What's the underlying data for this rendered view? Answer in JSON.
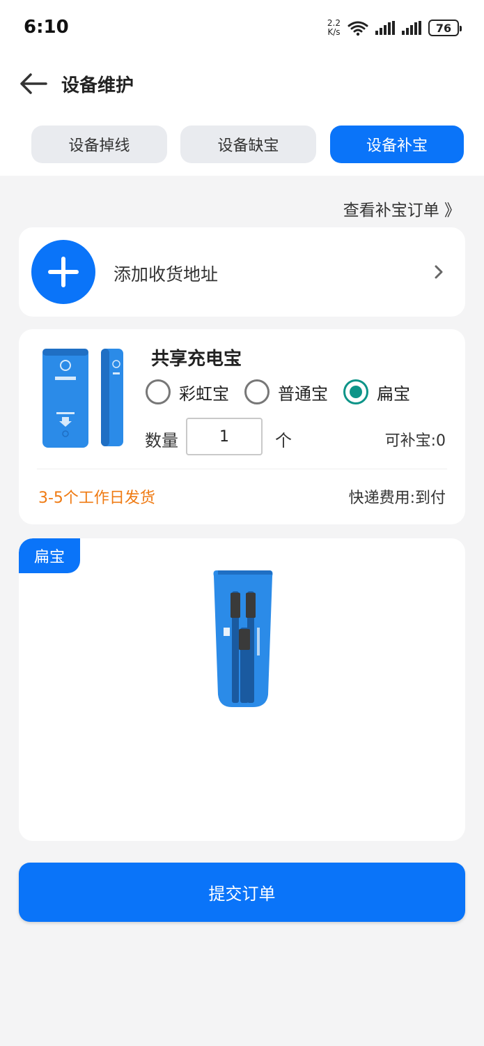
{
  "status_bar": {
    "time": "6:10",
    "net_speed_value": "2.2",
    "net_speed_unit": "K/s",
    "battery": "76"
  },
  "header": {
    "title": "设备维护",
    "back_icon": "arrow-left-icon"
  },
  "tabs": [
    {
      "label": "设备掉线",
      "active": false
    },
    {
      "label": "设备缺宝",
      "active": false
    },
    {
      "label": "设备补宝",
      "active": true
    }
  ],
  "orders_link": "查看补宝订单 》",
  "address": {
    "label": "添加收货地址",
    "icon": "plus-circle-icon"
  },
  "product": {
    "name": "共享充电宝",
    "options": [
      {
        "label": "彩虹宝",
        "selected": false
      },
      {
        "label": "普通宝",
        "selected": false
      },
      {
        "label": "扁宝",
        "selected": true
      }
    ],
    "quantity_label": "数量",
    "quantity_value": "1",
    "quantity_unit": "个",
    "available": "可补宝:0",
    "ship_time": "3-5个工作日发货",
    "ship_fee": "快递费用:到付"
  },
  "preview": {
    "tag": "扁宝"
  },
  "submit_label": "提交订单",
  "colors": {
    "accent": "#0a74f9",
    "radio_selected": "#0d9488",
    "ship_time": "#ef7a12"
  }
}
